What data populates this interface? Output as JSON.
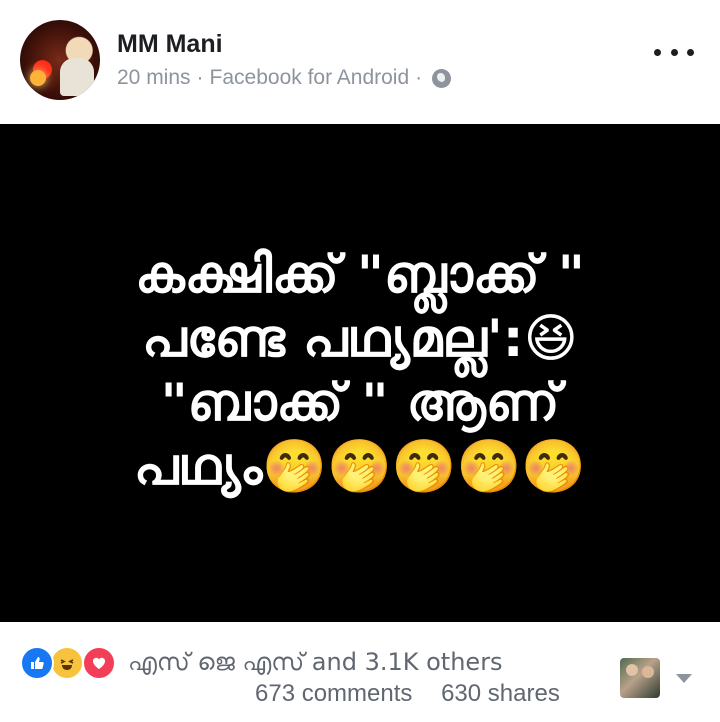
{
  "header": {
    "author_name": "MM Mani",
    "time": "20 mins",
    "separator": "·",
    "source": "Facebook for Android",
    "audience_icon": "globe-icon",
    "menu_icon": "more-options-icon"
  },
  "post": {
    "text": "കക്ഷിക്ക് \"ബ്ലാക്ക് \"\nപണ്ടേ പഥ്യമല്ല':😆\n\"ബാക്ക് \" ആണ്\nപഥ്യം🤭🤭🤭🤭🤭"
  },
  "footer": {
    "reaction_icons": [
      "like-icon",
      "haha-icon",
      "love-icon"
    ],
    "reactions_text": "എസ് ജെ എസ് and 3.1K others",
    "comments": "673 comments",
    "shares": "630 shares"
  },
  "colors": {
    "brand_blue": "#1877f2",
    "post_background": "#000000",
    "secondary_text": "#606770"
  }
}
